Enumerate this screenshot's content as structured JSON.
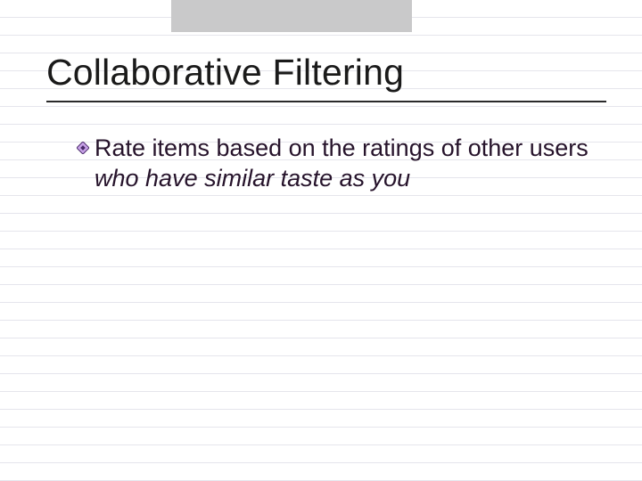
{
  "slide": {
    "title": "Collaborative Filtering",
    "bullet": {
      "text_part1": "Rate items based on the ratings of other users ",
      "text_italic": "who have similar taste as you"
    }
  },
  "icons": {
    "bullet": "diamond-icon"
  },
  "colors": {
    "topbar": "#c9c9ca",
    "title": "#1a1a1a",
    "text": "#26132b",
    "diamond_border": "#4a2a6a",
    "diamond_fill": "#c8a2e8"
  }
}
